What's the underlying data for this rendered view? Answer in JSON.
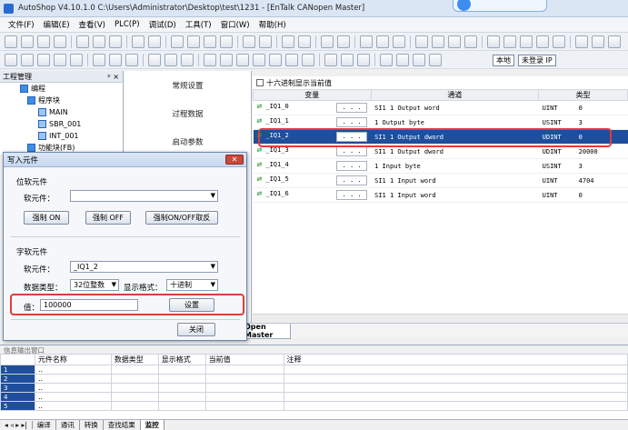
{
  "window": {
    "title": "AutoShop V4.10.1.0  C:\\Users\\Administrator\\Desktop\\test\\1231 - [EnTalk CANopen Master]"
  },
  "menu": [
    "文件(F)",
    "编辑(E)",
    "查看(V)",
    "PLC(P)",
    "调试(D)",
    "工具(T)",
    "窗口(W)",
    "帮助(H)"
  ],
  "toolbar": {
    "local_label": "本地",
    "login_label": "未登录 IP"
  },
  "project_panel": {
    "title": "工程管理",
    "pin": "ᵖ ×",
    "items": [
      "编程",
      "程序块",
      "MAIN",
      "SBR_001",
      "INT_001",
      "功能块(FB)"
    ]
  },
  "settings_list": [
    "常规设置",
    "过程数据",
    "启动参数"
  ],
  "table": {
    "hex_checkbox_label": "十六进制显示当前值",
    "columns": [
      "变量",
      "通道",
      "类型"
    ],
    "rows": [
      {
        "var": "_IQ1_0",
        "channel": "SI1 1 Output word",
        "type": "UINT",
        "value": "0"
      },
      {
        "var": "_IQ1_1",
        "channel": "1 Output byte",
        "type": "USINT",
        "value": "3"
      },
      {
        "var": "_IQ1_2",
        "channel": "SI1 1 Output dword",
        "type": "UDINT",
        "value": "0"
      },
      {
        "var": "_IQ1_3",
        "channel": "SI1 1 Output dword",
        "type": "UDINT",
        "value": "20000"
      },
      {
        "var": "_IQ1_4",
        "channel": "1 Input byte",
        "type": "USINT",
        "value": "3"
      },
      {
        "var": "_IQ1_5",
        "channel": "SI1 1 Input word",
        "type": "UINT",
        "value": "4704"
      },
      {
        "var": "_IQ1_6",
        "channel": "SI1 1 Input word",
        "type": "UINT",
        "value": "0"
      }
    ],
    "selected_row": 2
  },
  "master_tab": "Open Master",
  "info_panel": {
    "title": "信息输出窗口",
    "columns": [
      "元件名称",
      "数据类型",
      "显示格式",
      "当前值",
      "注释"
    ],
    "rows": [
      "1",
      "2",
      "3",
      "4",
      "5"
    ]
  },
  "bottom_tabs": [
    "编译",
    "通讯",
    "转换",
    "查找结果",
    "监控"
  ],
  "dialog": {
    "title": "写入元件",
    "bit_group": "位软元件",
    "bit_label": "软元件：",
    "force_on": "强制 ON",
    "force_off": "强制 OFF",
    "force_toggle": "强制ON/OFF取反",
    "word_group": "字软元件",
    "word_label": "软元件：",
    "word_value": "_IQ1_2",
    "dtype_label": "数据类型：",
    "dtype_value": "32位整数",
    "format_label": "显示格式：",
    "format_value": "十进制",
    "value_label": "值：",
    "value_input": "100000",
    "set_button": "设置",
    "close_button": "关闭"
  }
}
